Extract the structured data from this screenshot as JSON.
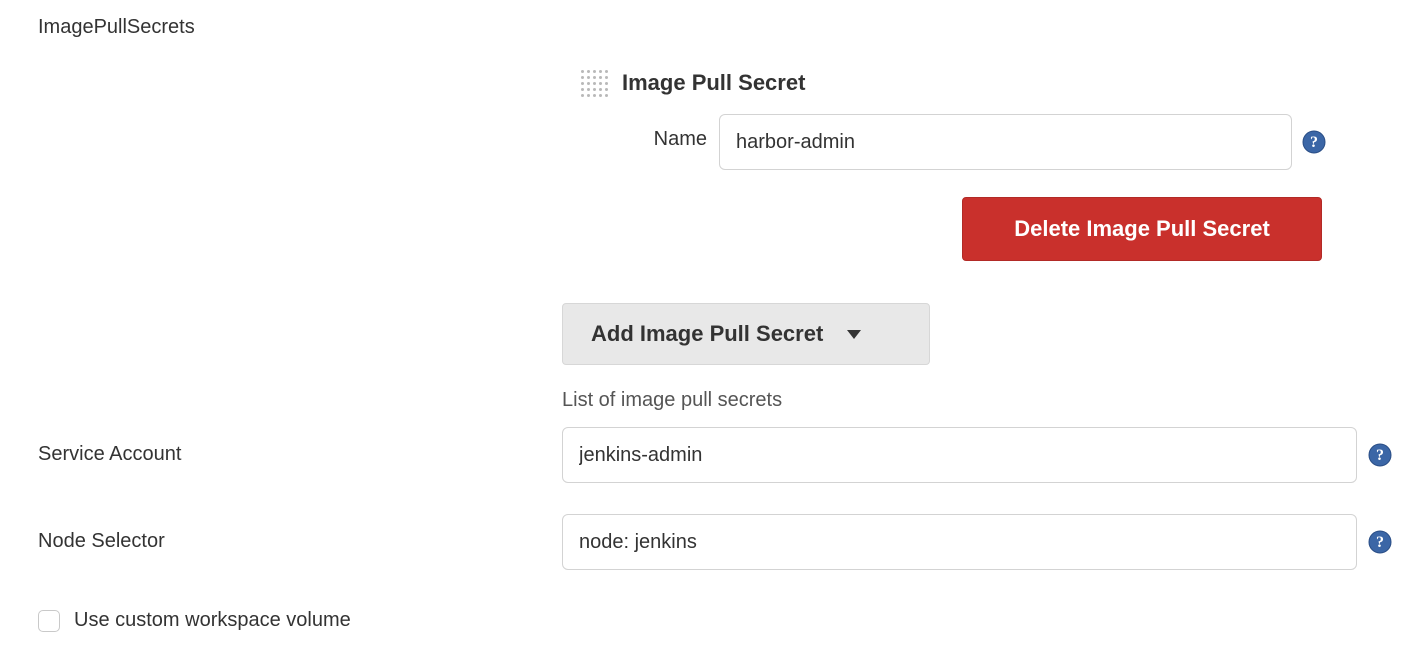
{
  "labels": {
    "imagePullSecrets": "ImagePullSecrets",
    "imagePullSecretHeading": "Image Pull Secret",
    "name": "Name",
    "serviceAccount": "Service Account",
    "nodeSelector": "Node Selector",
    "listDescription": "List of image pull secrets",
    "useCustomWorkspaceVolume": "Use custom workspace volume"
  },
  "buttons": {
    "delete": "Delete Image Pull Secret",
    "add": "Add Image Pull Secret"
  },
  "values": {
    "secretName": "harbor-admin",
    "serviceAccount": "jenkins-admin",
    "nodeSelector": "node: jenkins",
    "useCustomWorkspaceVolume": false
  }
}
